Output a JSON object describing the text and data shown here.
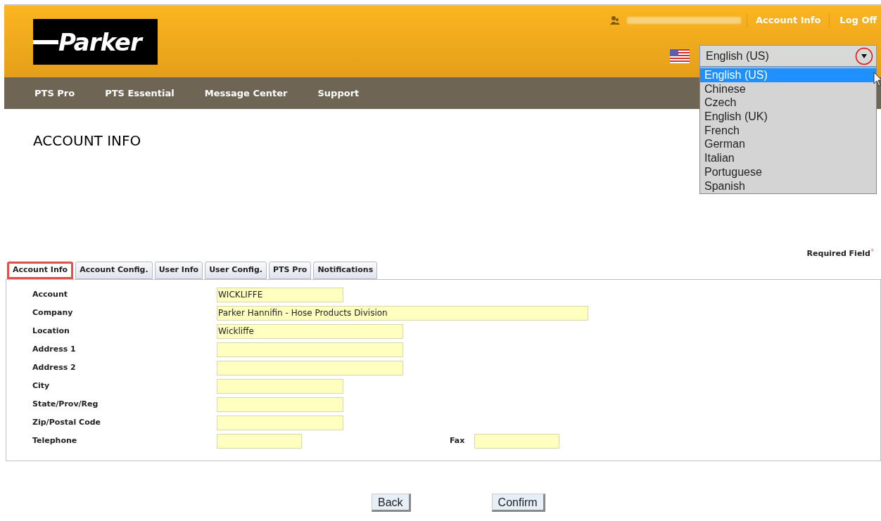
{
  "header": {
    "logo": "Parker",
    "account_link": "Account Info",
    "logoff_link": "Log Off",
    "language": {
      "value": "English (US)",
      "expanded": true,
      "options": [
        {
          "label": "English (US)",
          "selected": true
        },
        {
          "label": "Chinese",
          "selected": false
        },
        {
          "label": "Czech",
          "selected": false
        },
        {
          "label": "English (UK)",
          "selected": false
        },
        {
          "label": "French",
          "selected": false
        },
        {
          "label": "German",
          "selected": false
        },
        {
          "label": "Italian",
          "selected": false
        },
        {
          "label": "Portuguese",
          "selected": false
        },
        {
          "label": "Spanish",
          "selected": false
        }
      ]
    }
  },
  "nav": [
    "PTS Pro",
    "PTS Essential",
    "Message Center",
    "Support"
  ],
  "page_title": "ACCOUNT INFO",
  "required_note": "Required Field",
  "required_mark": "*",
  "tabs": [
    {
      "label": "Account Info",
      "selected": true
    },
    {
      "label": "Account Config.",
      "selected": false
    },
    {
      "label": "User Info",
      "selected": false
    },
    {
      "label": "User Config.",
      "selected": false
    },
    {
      "label": "PTS Pro",
      "selected": false
    },
    {
      "label": "Notifications",
      "selected": false
    }
  ],
  "fields": [
    {
      "label": "Account",
      "value": "WICKLIFFE",
      "kind": "medium"
    },
    {
      "label": "Company",
      "value": "Parker Hannifin - Hose Products Division",
      "kind": "long"
    },
    {
      "label": "Location",
      "value": "Wickliffe",
      "kind": "wide"
    },
    {
      "label": "Address 1",
      "kind": "wide"
    },
    {
      "label": "Address 2",
      "kind": "wide"
    },
    {
      "label": "City",
      "kind": "medium"
    },
    {
      "label": "State/Prov/Reg",
      "kind": "medium"
    },
    {
      "label": "Zip/Postal Code",
      "kind": "medium"
    },
    {
      "label": "Telephone",
      "kind": "short",
      "extra": {
        "label": "Fax"
      }
    }
  ],
  "buttons": [
    "Back",
    "Confirm"
  ]
}
